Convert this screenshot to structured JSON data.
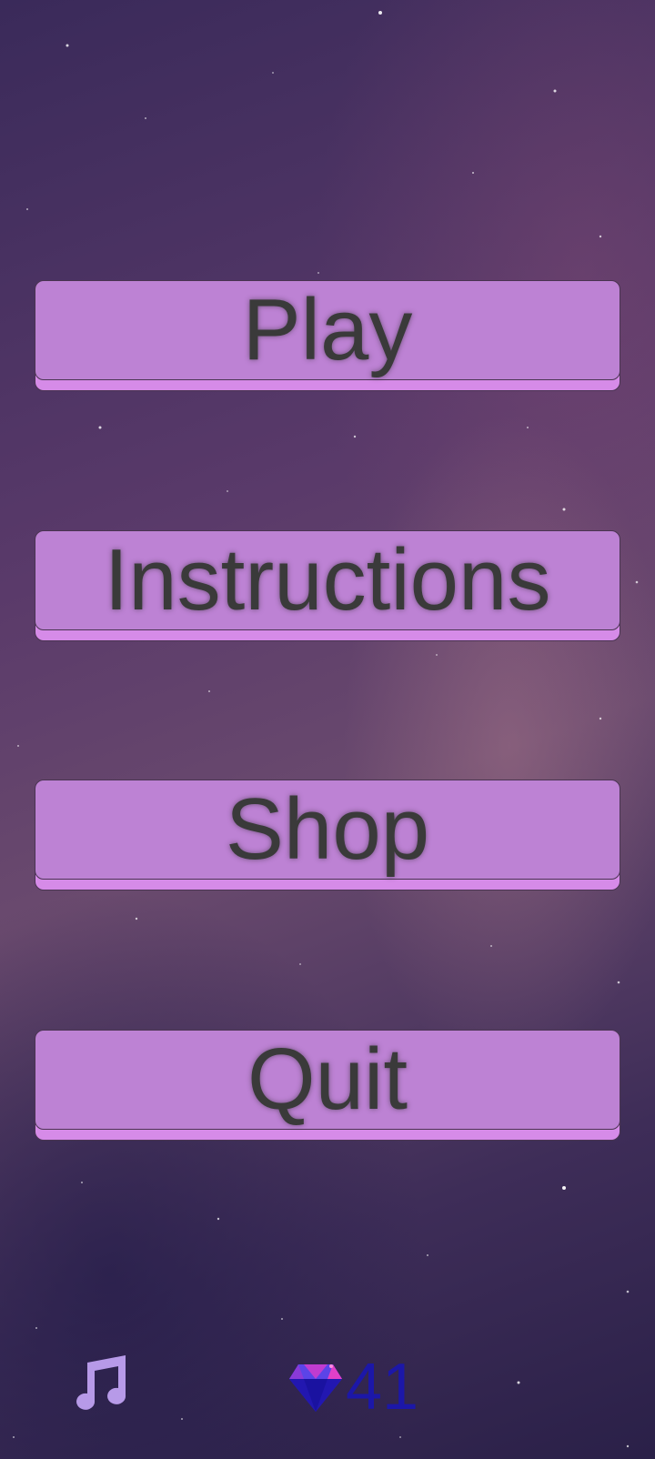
{
  "menu": {
    "play_label": "Play",
    "instructions_label": "Instructions",
    "shop_label": "Shop",
    "quit_label": "Quit"
  },
  "footer": {
    "music_icon": "music-note-icon",
    "gem_icon": "gem-icon",
    "gem_count": "41"
  },
  "colors": {
    "button_face": "#bd82d4",
    "button_base": "#d68be8",
    "button_text": "#3a3a3a",
    "music_icon": "#b79ae8",
    "gem_count_text": "#1c17a8",
    "gem_blue": "#2a1fd0",
    "gem_pink": "#e040c8"
  }
}
